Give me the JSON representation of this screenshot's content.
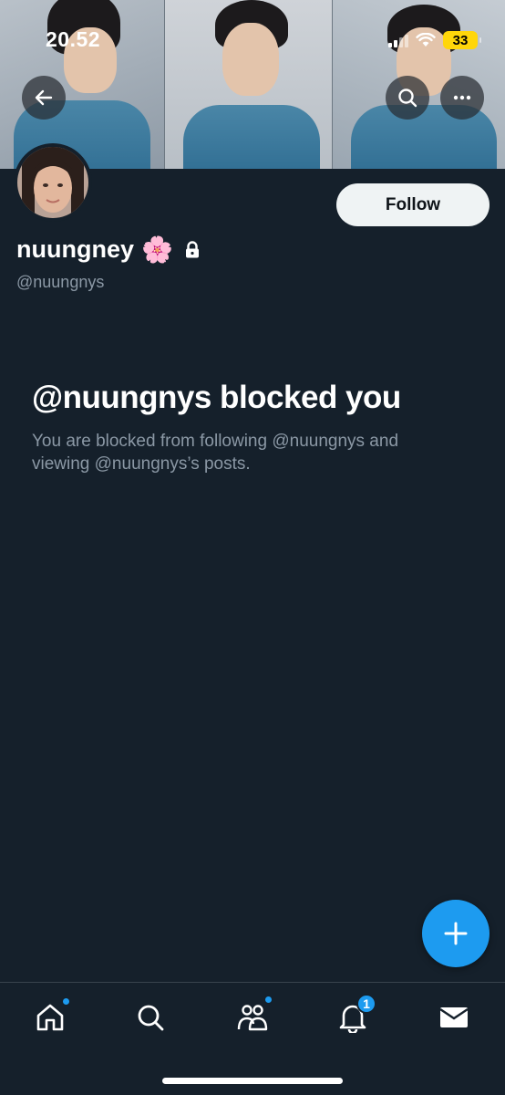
{
  "status_bar": {
    "time": "20.52",
    "battery": "33"
  },
  "profile": {
    "display_name": "nuungney",
    "emoji": "🌸",
    "handle": "@nuungnys",
    "follow_label": "Follow"
  },
  "blocked": {
    "title": "@nuungnys blocked you",
    "description": "You are blocked from following @nuungnys and viewing @nuungnys’s posts."
  },
  "nav": {
    "notifications_badge": "1",
    "items": [
      "home-icon",
      "search-icon",
      "communities-icon",
      "bell-icon",
      "mail-icon"
    ]
  },
  "colors": {
    "background": "#15202b",
    "accent": "#1d9bf0",
    "secondary_text": "#8b98a5",
    "battery": "#ffd60a"
  }
}
